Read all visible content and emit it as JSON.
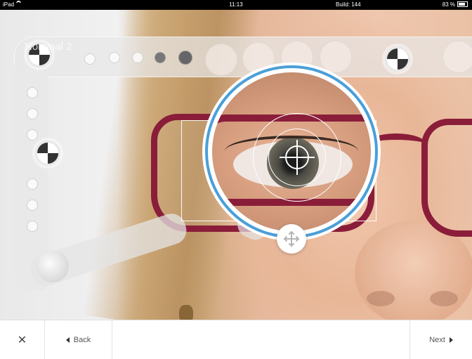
{
  "status_bar": {
    "device": "iPad",
    "time": "11:13",
    "build": "Build: 144",
    "battery": "83 %"
  },
  "view": {
    "title": "Nominal 2"
  },
  "icons": {
    "wifi": "wifi-icon",
    "battery": "battery-icon",
    "move": "move-arrows-icon",
    "close": "close-icon",
    "back": "triangle-left-icon",
    "next": "triangle-right-icon"
  },
  "colors": {
    "magnifier_ring": "#4a9fd8",
    "frame": "#8a1d3a"
  },
  "toolbar": {
    "close_label": "✕",
    "back_label": "Back",
    "next_label": "Next"
  }
}
